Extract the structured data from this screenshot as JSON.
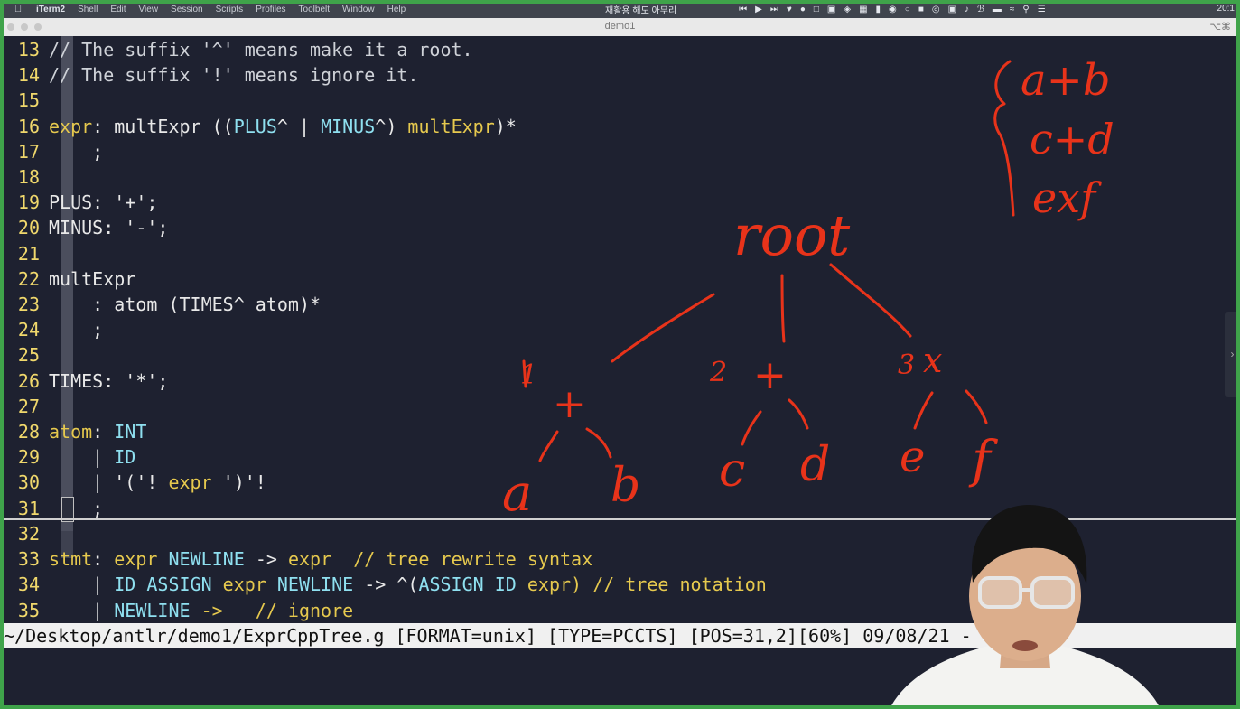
{
  "menubar": {
    "app_name": "iTerm2",
    "items": [
      "Shell",
      "Edit",
      "View",
      "Session",
      "Scripts",
      "Profiles",
      "Toolbelt",
      "Window",
      "Help"
    ],
    "right_text": "재활용 해도 아무리",
    "clock": "20:1"
  },
  "window": {
    "title": "demo1",
    "shortcut": "⌥⌘"
  },
  "editor": {
    "lines": [
      {
        "n": "13",
        "parts": [
          {
            "t": "// The suffix '^' means make it a root.",
            "c": "gy"
          }
        ]
      },
      {
        "n": "14",
        "parts": [
          {
            "t": "// The suffix '!' means ignore it.",
            "c": "gy"
          }
        ]
      },
      {
        "n": "15",
        "parts": []
      },
      {
        "n": "16",
        "parts": [
          {
            "t": "expr",
            "c": "kw"
          },
          {
            "t": ": multExpr ((",
            "c": ""
          },
          {
            "t": "PLUS",
            "c": "cy"
          },
          {
            "t": "^ | ",
            "c": ""
          },
          {
            "t": "MINUS",
            "c": "cy"
          },
          {
            "t": "^) ",
            "c": ""
          },
          {
            "t": "multExpr",
            "c": "kw"
          },
          {
            "t": ")*",
            "c": ""
          }
        ]
      },
      {
        "n": "17",
        "parts": [
          {
            "t": "    ;",
            "c": ""
          }
        ]
      },
      {
        "n": "18",
        "parts": []
      },
      {
        "n": "19",
        "parts": [
          {
            "t": "PLUS: '+';",
            "c": ""
          }
        ]
      },
      {
        "n": "20",
        "parts": [
          {
            "t": "MINUS: '-';",
            "c": ""
          }
        ]
      },
      {
        "n": "21",
        "parts": []
      },
      {
        "n": "22",
        "parts": [
          {
            "t": "multExpr",
            "c": ""
          }
        ]
      },
      {
        "n": "23",
        "parts": [
          {
            "t": "    : atom (TIMES^ atom)*",
            "c": ""
          }
        ]
      },
      {
        "n": "24",
        "parts": [
          {
            "t": "    ;",
            "c": ""
          }
        ]
      },
      {
        "n": "25",
        "parts": []
      },
      {
        "n": "26",
        "parts": [
          {
            "t": "TIMES: '*';",
            "c": ""
          }
        ]
      },
      {
        "n": "27",
        "parts": []
      },
      {
        "n": "28",
        "parts": [
          {
            "t": "atom",
            "c": "kw"
          },
          {
            "t": ": ",
            "c": ""
          },
          {
            "t": "INT",
            "c": "cy"
          }
        ]
      },
      {
        "n": "29",
        "parts": [
          {
            "t": "    | ",
            "c": ""
          },
          {
            "t": "ID",
            "c": "cy"
          }
        ]
      },
      {
        "n": "30",
        "parts": [
          {
            "t": "    | '('! ",
            "c": ""
          },
          {
            "t": "expr",
            "c": "kw"
          },
          {
            "t": " ')'!",
            "c": ""
          }
        ]
      },
      {
        "n": "31",
        "parts": [
          {
            "t": "    ;",
            "c": ""
          }
        ]
      },
      {
        "n": "32",
        "parts": []
      },
      {
        "n": "33",
        "parts": [
          {
            "t": "stmt",
            "c": "kw"
          },
          {
            "t": ": ",
            "c": ""
          },
          {
            "t": "expr",
            "c": "kw"
          },
          {
            "t": " ",
            "c": ""
          },
          {
            "t": "NEWLINE",
            "c": "cy"
          },
          {
            "t": " -> ",
            "c": ""
          },
          {
            "t": "expr",
            "c": "kw"
          },
          {
            "t": "  // tree rewrite syntax",
            "c": "kw"
          }
        ]
      },
      {
        "n": "34",
        "parts": [
          {
            "t": "    | ",
            "c": ""
          },
          {
            "t": "ID ASSIGN",
            "c": "cy"
          },
          {
            "t": " ",
            "c": ""
          },
          {
            "t": "expr",
            "c": "kw"
          },
          {
            "t": " ",
            "c": ""
          },
          {
            "t": "NEWLINE",
            "c": "cy"
          },
          {
            "t": " -> ^(",
            "c": ""
          },
          {
            "t": "ASSIGN ID",
            "c": "cy"
          },
          {
            "t": " ",
            "c": ""
          },
          {
            "t": "expr",
            "c": "kw"
          },
          {
            "t": ") // tree notation",
            "c": "kw"
          }
        ]
      },
      {
        "n": "35",
        "parts": [
          {
            "t": "    | ",
            "c": ""
          },
          {
            "t": "NEWLINE",
            "c": "cy"
          },
          {
            "t": " ->   // ignore",
            "c": "kw"
          }
        ]
      }
    ]
  },
  "statusbar": {
    "text": "~/Desktop/antlr/demo1/ExprCppTree.g [FORMAT=unix] [TYPE=PCCTS] [POS=31,2][60%] 09/08/21 -"
  },
  "annotations": {
    "ink_color": "#e8331a",
    "root_label": "root",
    "nodes": [
      "1",
      "+",
      "a",
      "b",
      "2",
      "+",
      "c",
      "d",
      "3",
      "x",
      "e",
      "f"
    ],
    "list": [
      "a+b",
      "c+d",
      "exf"
    ]
  }
}
